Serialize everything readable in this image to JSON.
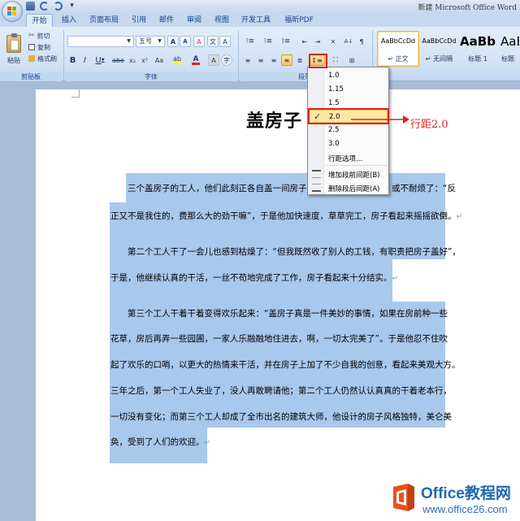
{
  "window": {
    "title": "新建 Microsoft Office Word"
  },
  "tabs": [
    {
      "label": "开始"
    },
    {
      "label": "插入"
    },
    {
      "label": "页面布局"
    },
    {
      "label": "引用"
    },
    {
      "label": "邮件"
    },
    {
      "label": "审阅"
    },
    {
      "label": "视图"
    },
    {
      "label": "开发工具"
    },
    {
      "label": "福昕PDF"
    }
  ],
  "clipboard": {
    "paste": "粘贴",
    "cut": "剪切",
    "copy": "复制",
    "format_painter": "格式刷",
    "group": "剪贴板"
  },
  "font": {
    "name": "",
    "size": "五号",
    "bold": "B",
    "italic": "I",
    "underline": "U",
    "strike": "abe",
    "subscript": "x₂",
    "superscript": "x²",
    "case": "Aa",
    "grow": "A",
    "shrink": "A",
    "clear": "A",
    "group": "字体",
    "char_border": "A",
    "phonetic": "文",
    "enclose": "字"
  },
  "paragraph": {
    "group": "段落"
  },
  "styles": [
    {
      "sample": "AaBbCcDd",
      "name": "↵ 正文"
    },
    {
      "sample": "AaBbCcDd",
      "name": "↵ 无间隔"
    },
    {
      "sample": "AaBb",
      "name": "标题 1"
    },
    {
      "sample": "AaB",
      "name": "标题"
    }
  ],
  "line_spacing_menu": {
    "items": [
      "1.0",
      "1.15",
      "1.5",
      "2.0",
      "2.5",
      "3.0"
    ],
    "checked": "2.0",
    "options": "行距选项...",
    "add_before": "增加段前间距(B)",
    "remove_after": "删除段后间距(A)"
  },
  "annotation": {
    "text": "行距2.0",
    "color": "#e02020"
  },
  "document": {
    "title": "盖房子",
    "paragraphs": [
      "三个盖房子的工人，他们此刻正各自盖一间房子。",
      "或不耐烦了：“反",
      "正又不是我住的，费那么大的劲干嘛”，于是他加快速度，草草完工，房子看起来摇摇欲倒。",
      "第二个工人干了一会儿也感到枯燥了：“但我既然收了别人的工钱，有职责把房子盖好”，",
      "于是，他继续认真的干活，一丝不苟地完成了工作，房子看起来十分结实。",
      "第三个工人干着干着变得欢乐起来：“盖房子真是一件美妙的事情，如果在房前种一些",
      "花草，房后再弄一些园圃，一家人乐融融地住进去，啊，一切太完美了”。于是他忍不住吹",
      "起了欢乐的口哨，以更大的热情来干活，并在房子上加了不少自我的创意，看起来美观大方。",
      "三年之后，第一个工人失业了，没人再敢聘请他；第二个工人仍然认认真真的干着老本行，",
      "一切没有变化；而第三个工人却成了全市出名的建筑大师，他设计的房子风格独特，美仑美",
      "奂，受到了人们的欢迎。"
    ],
    "selection_color": "#a8c8ec"
  },
  "watermark": {
    "brand": "Office教程网",
    "url": "www.office26.com"
  }
}
